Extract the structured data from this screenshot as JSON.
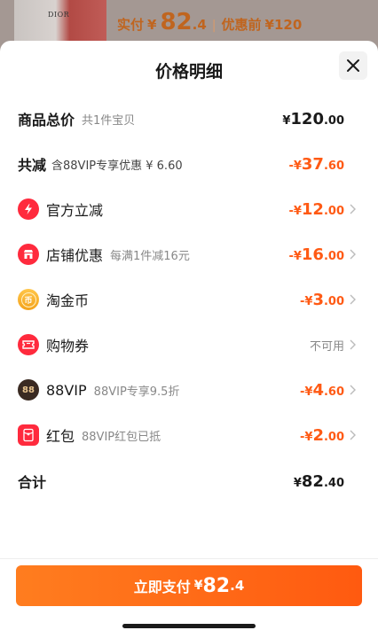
{
  "background": {
    "brand": "DIOR",
    "price_label": "实付",
    "currency": "¥",
    "price_int": "82",
    "price_dec": ".4",
    "separator": "|",
    "before_label": "优惠前",
    "before_price": "¥120"
  },
  "sheet": {
    "title": "价格明细",
    "close_icon": "close-icon"
  },
  "rows": {
    "total": {
      "label": "商品总价",
      "sub": "共1件宝贝",
      "cur": "¥",
      "int": "120",
      "dec": ".00"
    },
    "discount": {
      "label": "共减",
      "sub": "含88VIP专享优惠 ¥ 6.60",
      "cur": "-¥",
      "int": "37",
      "dec": ".60"
    },
    "official": {
      "label": "官方立减",
      "cur": "-¥",
      "int": "12",
      "dec": ".00",
      "icon": "lightning-icon"
    },
    "store": {
      "label": "店铺优惠",
      "sub": "每满1件减16元",
      "cur": "-¥",
      "int": "16",
      "dec": ".00",
      "icon": "store-icon"
    },
    "coins": {
      "label": "淘金币",
      "cur": "-¥",
      "int": "3",
      "dec": ".00",
      "icon": "coin-icon",
      "icon_text": "币"
    },
    "coupon": {
      "label": "购物券",
      "status": "不可用",
      "icon": "ticket-icon"
    },
    "vip": {
      "label": "88VIP",
      "sub": "88VIP专享9.5折",
      "cur": "-¥",
      "int": "4",
      "dec": ".60",
      "icon": "vip-icon",
      "icon_text": "88"
    },
    "redpacket": {
      "label": "红包",
      "sub": "88VIP红包已抵",
      "cur": "-¥",
      "int": "2",
      "dec": ".00",
      "icon": "red-packet-icon"
    },
    "subtotal": {
      "label": "合计",
      "cur": "¥",
      "int": "82",
      "dec": ".40"
    }
  },
  "pay_button": {
    "label": "立即支付",
    "cur": "¥",
    "int": "82",
    "dec": ".4"
  },
  "colors": {
    "accent": "#ff5a14",
    "red_icon": "#ff2a3d",
    "gold_icon": "#f4a21b"
  }
}
